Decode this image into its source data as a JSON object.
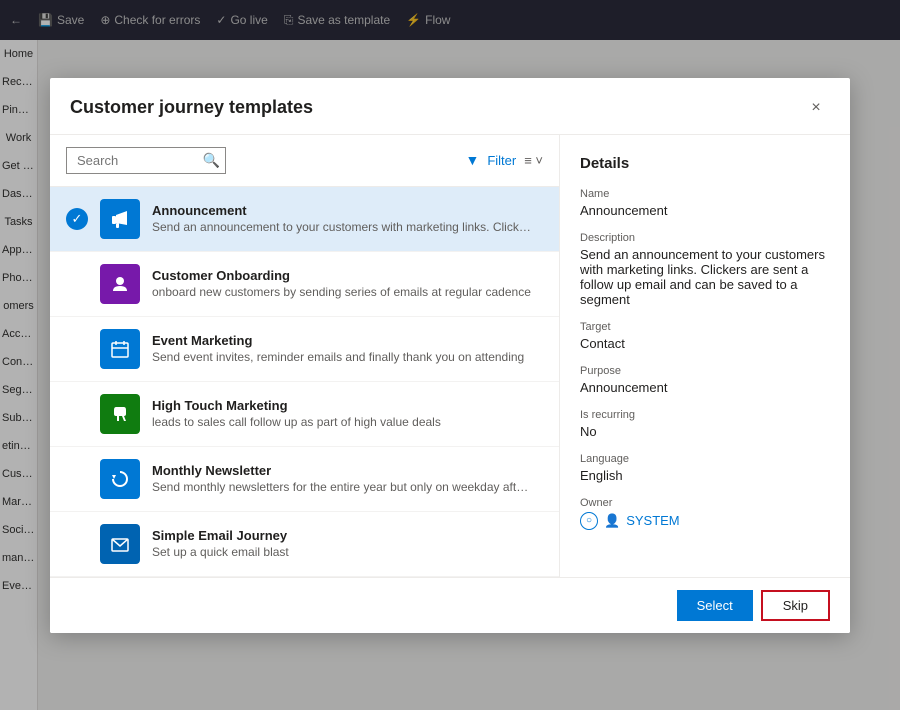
{
  "dialog": {
    "title": "Customer journey templates",
    "close_label": "×"
  },
  "search": {
    "placeholder": "Search",
    "value": ""
  },
  "filter": {
    "label": "Filter"
  },
  "templates": [
    {
      "id": "announcement",
      "name": "Announcement",
      "description": "Send an announcement to your customers with marketing links. Clickers are sent a...",
      "icon_color": "#0078d4",
      "icon": "📢",
      "selected": true
    },
    {
      "id": "customer-onboarding",
      "name": "Customer Onboarding",
      "description": "onboard new customers by sending series of emails at regular cadence",
      "icon_color": "#7719aa",
      "icon": "👤",
      "selected": false
    },
    {
      "id": "event-marketing",
      "name": "Event Marketing",
      "description": "Send event invites, reminder emails and finally thank you on attending",
      "icon_color": "#0078d4",
      "icon": "📅",
      "selected": false
    },
    {
      "id": "high-touch-marketing",
      "name": "High Touch Marketing",
      "description": "leads to sales call follow up as part of high value deals",
      "icon_color": "#107c10",
      "icon": "📞",
      "selected": false
    },
    {
      "id": "monthly-newsletter",
      "name": "Monthly Newsletter",
      "description": "Send monthly newsletters for the entire year but only on weekday afternoons",
      "icon_color": "#0078d4",
      "icon": "🔄",
      "selected": false
    },
    {
      "id": "simple-email-journey",
      "name": "Simple Email Journey",
      "description": "Set up a quick email blast",
      "icon_color": "#0063b1",
      "icon": "✉️",
      "selected": false
    }
  ],
  "details": {
    "section_title": "Details",
    "fields": [
      {
        "label": "Name",
        "value": "Announcement"
      },
      {
        "label": "Description",
        "value": "Send an announcement to your customers with marketing links. Clickers are sent a follow up email and can be saved to a segment"
      },
      {
        "label": "Target",
        "value": "Contact"
      },
      {
        "label": "Purpose",
        "value": "Announcement"
      },
      {
        "label": "Is recurring",
        "value": "No"
      },
      {
        "label": "Language",
        "value": "English"
      },
      {
        "label": "Owner",
        "value": "SYSTEM"
      }
    ]
  },
  "footer": {
    "select_label": "Select",
    "skip_label": "Skip"
  },
  "toolbar": {
    "back_label": "←",
    "save_label": "Save",
    "check_errors_label": "Check for errors",
    "go_live_label": "Go live",
    "save_as_template_label": "Save as template",
    "flow_label": "Flow"
  },
  "sidebar_items": [
    "Home",
    "Recent",
    "Pinned",
    "Work",
    "Get star",
    "Dashbo",
    "Tasks",
    "Appoint",
    "Phone C",
    "omers",
    "Account",
    "Contact",
    "Segment",
    "Subscri",
    "eting ex",
    "Custome",
    "Marketi",
    "Social p",
    "manag",
    "Events"
  ]
}
